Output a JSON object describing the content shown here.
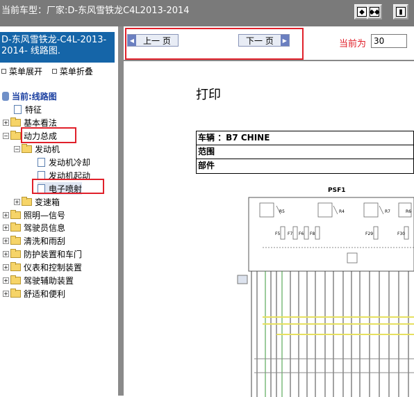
{
  "titlebar": {
    "title": "当前车型：厂家:D-东风雪铁龙C4L2013-2014"
  },
  "sidebar": {
    "header": "D-东风雪铁龙-C4L-2013-2014- 线路图.",
    "expand_all": "菜单展开",
    "collapse_all": "菜单折叠",
    "tree": {
      "root": "当前:线路图",
      "items": [
        {
          "label": "特征"
        },
        {
          "label": "基本看法"
        },
        {
          "label": "动力总成"
        },
        {
          "label": "发动机"
        },
        {
          "label": "发动机冷却"
        },
        {
          "label": "发动机起动"
        },
        {
          "label": "电子喷射"
        },
        {
          "label": "变速箱"
        },
        {
          "label": "照明—信号"
        },
        {
          "label": "驾驶员信息"
        },
        {
          "label": "清洗和雨刮"
        },
        {
          "label": "防护装置和车门"
        },
        {
          "label": "仪表和控制装置"
        },
        {
          "label": "驾驶辅助装置"
        },
        {
          "label": "舒适和便利"
        }
      ]
    }
  },
  "nav": {
    "prev_label": "上一 页",
    "next_label": "下一 页",
    "current_label": "当前为",
    "page_value": "30"
  },
  "document": {
    "print_label": "打印",
    "rows": [
      "车辆 ：B7 CHINE",
      "范围",
      "部件"
    ],
    "diagram_title": "PSF1",
    "fuse_labels": [
      "F5",
      "F7",
      "F6",
      "F8",
      "F29",
      "F30"
    ],
    "relay_labels": [
      "R5",
      "R4",
      "R7",
      "R6"
    ]
  },
  "colors": {
    "accent_red": "#e0202a",
    "header_blue": "#1565a8",
    "folder_yellow": "#f6d468"
  }
}
